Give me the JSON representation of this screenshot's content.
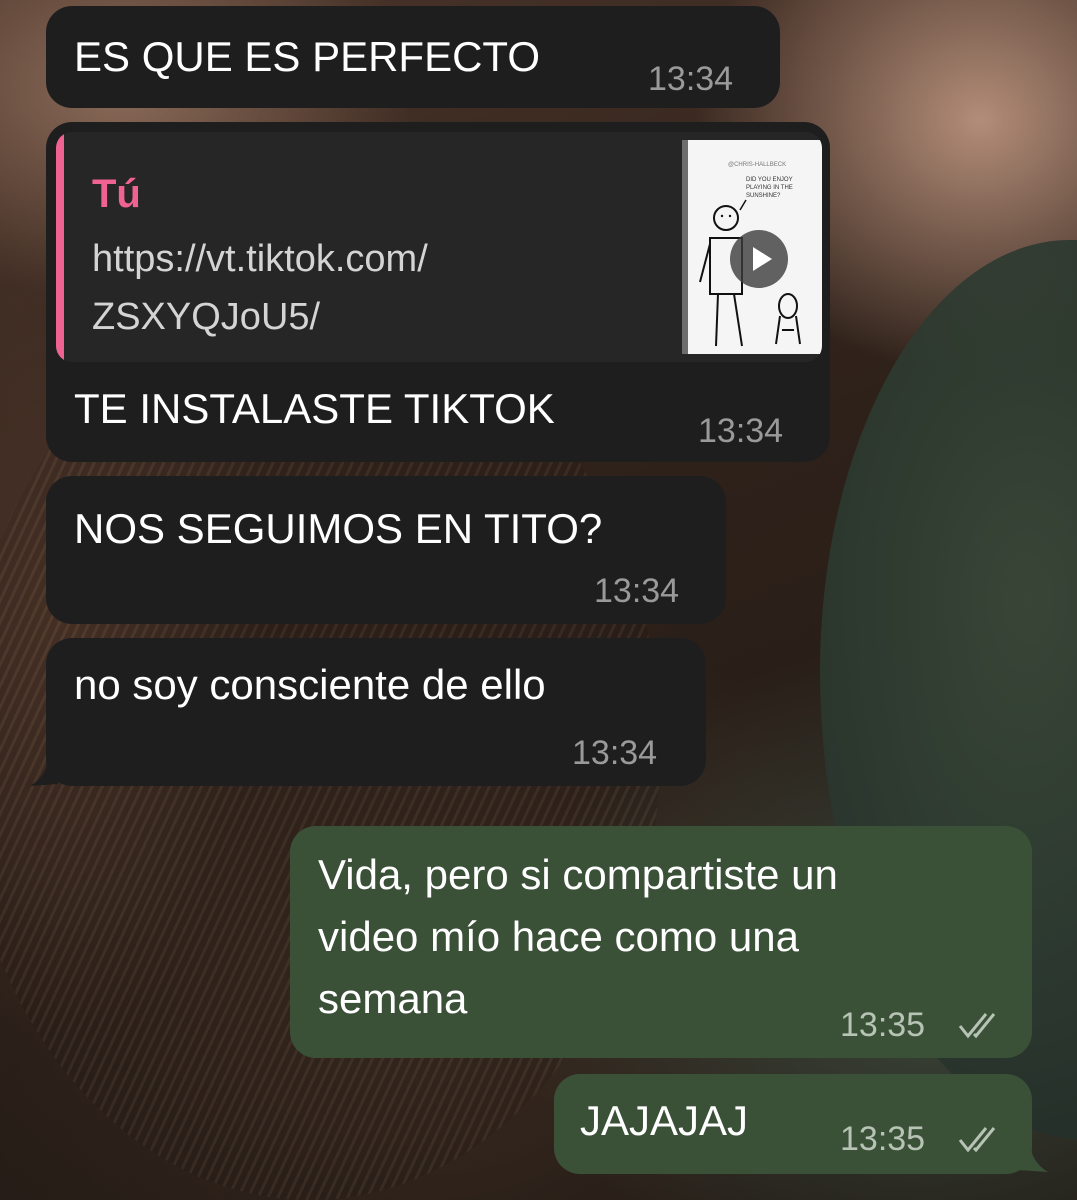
{
  "messages": [
    {
      "text": "ES QUE ES PERFECTO",
      "time": "13:34"
    },
    {
      "reply": {
        "sender": "Tú",
        "url_line1": "https://vt.tiktok.com/",
        "url_line2": "ZSXYQJoU5/",
        "thumbnail_credit": "@CHRIS-HALLBECK",
        "thumbnail_caption": "DID YOU ENJOY PLAYING IN THE SUNSHINE?"
      },
      "text": "TE INSTALASTE TIKTOK",
      "time": "13:34"
    },
    {
      "text": "NOS SEGUIMOS EN TITO?",
      "time": "13:34"
    },
    {
      "text": "no soy consciente de ello",
      "time": "13:34"
    },
    {
      "lines": [
        "Vida, pero si compartiste un",
        "video mío hace como una",
        "semana"
      ],
      "time": "13:35"
    },
    {
      "text": "JAJAJAJ",
      "time": "13:35"
    }
  ],
  "colors": {
    "incoming_bubble": "#1e1e1f",
    "outgoing_bubble": "#3a5138",
    "reply_accent": "#f06292"
  },
  "icons": {
    "read_status": "double-check-icon",
    "video_play": "play-icon"
  }
}
